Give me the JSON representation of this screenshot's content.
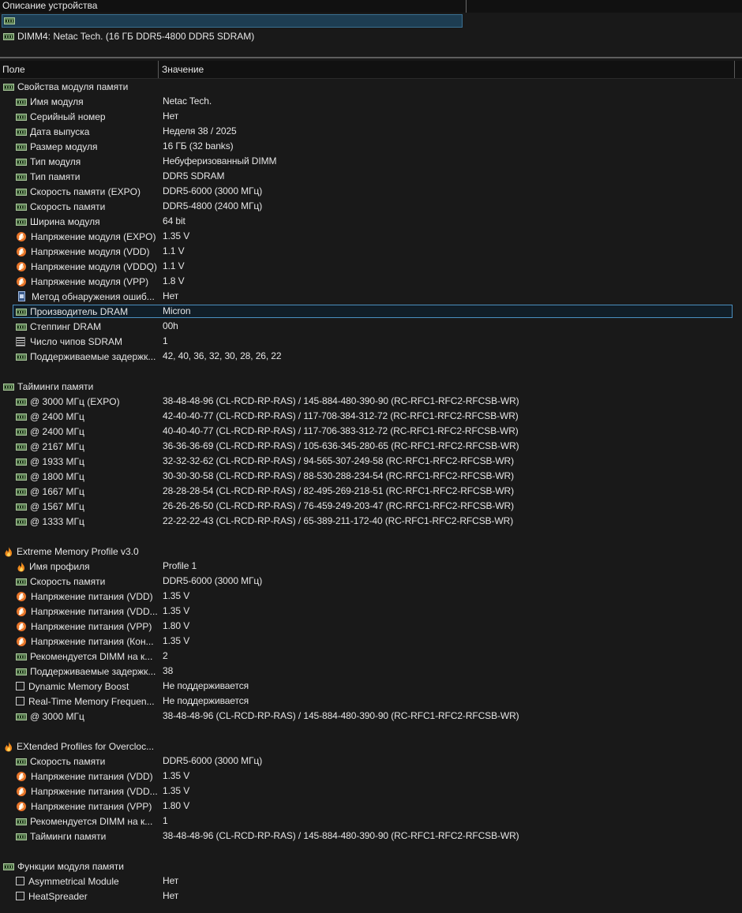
{
  "top_pane": {
    "header_label": "Описание устройства",
    "device_item": "DIMM4: Netac Tech. (16 ГБ DDR5-4800 DDR5 SDRAM)"
  },
  "list_header": {
    "field_col": "Поле",
    "value_col": "Значение"
  },
  "groups": [
    {
      "title": "Свойства модуля памяти",
      "icon": "ram-icon",
      "rows": [
        {
          "field": "Имя модуля",
          "value": "Netac Tech.",
          "icon": "ram-icon"
        },
        {
          "field": "Серийный номер",
          "value": "Нет",
          "icon": "ram-icon"
        },
        {
          "field": "Дата выпуска",
          "value": "Неделя 38 / 2025",
          "icon": "ram-icon"
        },
        {
          "field": "Размер модуля",
          "value": "16 ГБ (32 banks)",
          "icon": "ram-icon"
        },
        {
          "field": "Тип модуля",
          "value": "Небуферизованный DIMM",
          "icon": "ram-icon"
        },
        {
          "field": "Тип памяти",
          "value": "DDR5 SDRAM",
          "icon": "ram-icon"
        },
        {
          "field": "Скорость памяти (EXPO)",
          "value": "DDR5-6000 (3000 МГц)",
          "icon": "ram-icon"
        },
        {
          "field": "Скорость памяти",
          "value": "DDR5-4800 (2400 МГц)",
          "icon": "ram-icon"
        },
        {
          "field": "Ширина модуля",
          "value": "64 bit",
          "icon": "ram-icon"
        },
        {
          "field": "Напряжение модуля (EXPO)",
          "value": "1.35 V",
          "icon": "voltage-icon"
        },
        {
          "field": "Напряжение модуля (VDD)",
          "value": "1.1 V",
          "icon": "voltage-icon"
        },
        {
          "field": "Напряжение модуля (VDDQ)",
          "value": "1.1 V",
          "icon": "voltage-icon"
        },
        {
          "field": "Напряжение модуля (VPP)",
          "value": "1.8 V",
          "icon": "voltage-icon"
        },
        {
          "field": "Метод обнаружения ошиб...",
          "value": "Нет",
          "icon": "chip-icon"
        },
        {
          "field": "Производитель DRAM",
          "value": "Micron",
          "icon": "ram-icon",
          "selected": true
        },
        {
          "field": "Степпинг DRAM",
          "value": "00h",
          "icon": "ram-icon"
        },
        {
          "field": "Число чипов SDRAM",
          "value": "1",
          "icon": "chips-icon"
        },
        {
          "field": "Поддерживаемые задержк...",
          "value": "42, 40, 36, 32, 30, 28, 26, 22",
          "icon": "ram-icon"
        }
      ]
    },
    {
      "title": "Тайминги памяти",
      "icon": "ram-icon",
      "rows": [
        {
          "field": "@ 3000 МГц (EXPO)",
          "value": "38-48-48-96  (CL-RCD-RP-RAS) / 145-884-480-390-90  (RC-RFC1-RFC2-RFCSB-WR)",
          "icon": "ram-icon"
        },
        {
          "field": "@ 2400 МГц",
          "value": "42-40-40-77  (CL-RCD-RP-RAS) / 117-708-384-312-72  (RC-RFC1-RFC2-RFCSB-WR)",
          "icon": "ram-icon"
        },
        {
          "field": "@ 2400 МГц",
          "value": "40-40-40-77  (CL-RCD-RP-RAS) / 117-706-383-312-72  (RC-RFC1-RFC2-RFCSB-WR)",
          "icon": "ram-icon"
        },
        {
          "field": "@ 2167 МГц",
          "value": "36-36-36-69  (CL-RCD-RP-RAS) / 105-636-345-280-65  (RC-RFC1-RFC2-RFCSB-WR)",
          "icon": "ram-icon"
        },
        {
          "field": "@ 1933 МГц",
          "value": "32-32-32-62  (CL-RCD-RP-RAS) / 94-565-307-249-58  (RC-RFC1-RFC2-RFCSB-WR)",
          "icon": "ram-icon"
        },
        {
          "field": "@ 1800 МГц",
          "value": "30-30-30-58  (CL-RCD-RP-RAS) / 88-530-288-234-54  (RC-RFC1-RFC2-RFCSB-WR)",
          "icon": "ram-icon"
        },
        {
          "field": "@ 1667 МГц",
          "value": "28-28-28-54  (CL-RCD-RP-RAS) / 82-495-269-218-51  (RC-RFC1-RFC2-RFCSB-WR)",
          "icon": "ram-icon"
        },
        {
          "field": "@ 1567 МГц",
          "value": "26-26-26-50  (CL-RCD-RP-RAS) / 76-459-249-203-47  (RC-RFC1-RFC2-RFCSB-WR)",
          "icon": "ram-icon"
        },
        {
          "field": "@ 1333 МГц",
          "value": "22-22-22-43  (CL-RCD-RP-RAS) / 65-389-211-172-40  (RC-RFC1-RFC2-RFCSB-WR)",
          "icon": "ram-icon"
        }
      ]
    },
    {
      "title": "Extreme Memory Profile v3.0",
      "icon": "flame-icon",
      "rows": [
        {
          "field": "Имя профиля",
          "value": "Profile 1",
          "icon": "flame-icon"
        },
        {
          "field": "Скорость памяти",
          "value": "DDR5-6000 (3000 МГц)",
          "icon": "ram-icon"
        },
        {
          "field": "Напряжение питания (VDD)",
          "value": "1.35 V",
          "icon": "voltage-icon"
        },
        {
          "field": "Напряжение питания (VDD...",
          "value": "1.35 V",
          "icon": "voltage-icon"
        },
        {
          "field": "Напряжение питания (VPP)",
          "value": "1.80 V",
          "icon": "voltage-icon"
        },
        {
          "field": "Напряжение питания (Кон...",
          "value": "1.35 V",
          "icon": "voltage-icon"
        },
        {
          "field": "Рекомендуется DIMM на к...",
          "value": "2",
          "icon": "ram-icon"
        },
        {
          "field": "Поддерживаемые задержк...",
          "value": "38",
          "icon": "ram-icon"
        },
        {
          "field": "Dynamic Memory Boost",
          "value": "Не поддерживается",
          "icon": "checkbox-icon"
        },
        {
          "field": "Real-Time Memory Frequen...",
          "value": "Не поддерживается",
          "icon": "checkbox-icon"
        },
        {
          "field": "@ 3000 МГц",
          "value": "38-48-48-96  (CL-RCD-RP-RAS) / 145-884-480-390-90  (RC-RFC1-RFC2-RFCSB-WR)",
          "icon": "ram-icon"
        }
      ]
    },
    {
      "title": "EXtended Profiles for Overcloc...",
      "icon": "flame-icon",
      "rows": [
        {
          "field": "Скорость памяти",
          "value": "DDR5-6000 (3000 МГц)",
          "icon": "ram-icon"
        },
        {
          "field": "Напряжение питания (VDD)",
          "value": "1.35 V",
          "icon": "voltage-icon"
        },
        {
          "field": "Напряжение питания (VDD...",
          "value": "1.35 V",
          "icon": "voltage-icon"
        },
        {
          "field": "Напряжение питания (VPP)",
          "value": "1.80 V",
          "icon": "voltage-icon"
        },
        {
          "field": "Рекомендуется DIMM на к...",
          "value": "1",
          "icon": "ram-icon"
        },
        {
          "field": "Тайминги памяти",
          "value": "38-48-48-96  (CL-RCD-RP-RAS) / 145-884-480-390-90  (RC-RFC1-RFC2-RFCSB-WR)",
          "icon": "ram-icon"
        }
      ]
    },
    {
      "title": "Функции модуля памяти",
      "icon": "ram-icon",
      "rows": [
        {
          "field": "Asymmetrical Module",
          "value": "Нет",
          "icon": "checkbox-icon"
        },
        {
          "field": "HeatSpreader",
          "value": "Нет",
          "icon": "checkbox-icon"
        }
      ]
    }
  ]
}
